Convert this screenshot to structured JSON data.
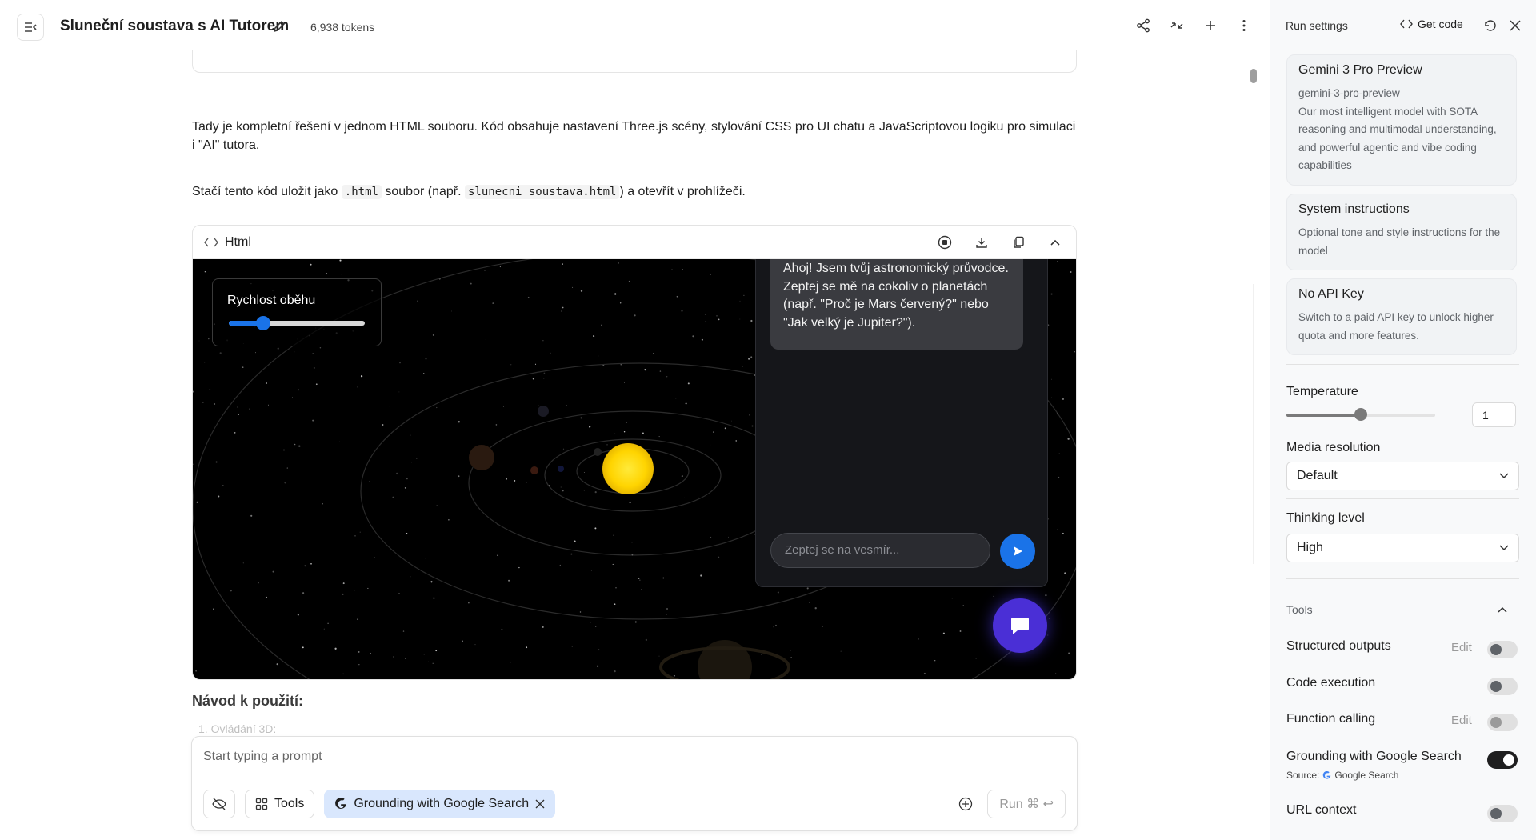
{
  "header": {
    "title": "Sluneční soustava s AI Tutorem",
    "tokens": "6,938 tokens"
  },
  "chat": {
    "paragraph1": "Tady je kompletní řešení v jednom HTML souboru. Kód obsahuje nastavení Three.js scény, stylování CSS pro UI chatu a JavaScriptovou logiku pro simulaci i \"AI\" tutora.",
    "paragraph2_a": "Stačí tento kód uložit jako ",
    "paragraph2_code1": ".html",
    "paragraph2_b": " soubor (např. ",
    "paragraph2_code2": "slunecni_soustava.html",
    "paragraph2_c": ") a otevřít v prohlížeči.",
    "code_lang": "Html",
    "howto_title": "Návod k použití:",
    "howto_item": "1. Ovládání 3D:"
  },
  "preview": {
    "speed_label": "Rychlost oběhu",
    "speed_value": 0.25,
    "ai_message": "Ahoj! Jsem tvůj astronomický průvodce. Zeptej se mě na cokoliv o planetách (např. \"Proč je Mars červený?\" nebo \"Jak velký je Jupiter?\").",
    "ai_input_placeholder": "Zeptej se na vesmír..."
  },
  "prompt": {
    "placeholder": "Start typing a prompt",
    "tools_label": "Tools",
    "grounding_chip": "Grounding with Google Search",
    "run_label": "Run ⌘ ↩"
  },
  "run_settings": {
    "title": "Run settings",
    "get_code": "Get code",
    "model": {
      "name": "Gemini 3 Pro Preview",
      "id": "gemini-3-pro-preview",
      "desc": "Our most intelligent model with SOTA reasoning and multimodal understanding, and powerful agentic and vibe coding capabilities"
    },
    "system_instructions": {
      "title": "System instructions",
      "desc": "Optional tone and style instructions for the model"
    },
    "api_key": {
      "title": "No API Key",
      "desc": "Switch to a paid API key to unlock higher quota and more features."
    },
    "temperature_label": "Temperature",
    "temperature_value": "1",
    "temperature_fraction": 0.5,
    "media_resolution_label": "Media resolution",
    "media_resolution_value": "Default",
    "thinking_level_label": "Thinking level",
    "thinking_level_value": "High",
    "tools_label": "Tools",
    "tools": {
      "structured_outputs": "Structured outputs",
      "code_execution": "Code execution",
      "function_calling": "Function calling",
      "grounding": "Grounding with Google Search",
      "grounding_source_label": "Source:",
      "grounding_source": "Google Search",
      "url_context": "URL context",
      "edit_label": "Edit"
    }
  },
  "colors": {
    "accent": "#1a73e8",
    "sun": "#ffd400",
    "fab": "#4a2fd6",
    "chip_blue": "#d9e7fd"
  }
}
